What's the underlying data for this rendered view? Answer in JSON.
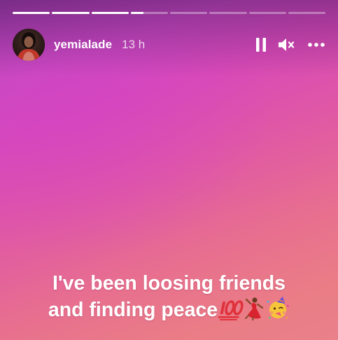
{
  "story": {
    "progress": {
      "segments": [
        1,
        1,
        1,
        0.35,
        0,
        0,
        0,
        0
      ]
    },
    "author": {
      "username": "yemialade",
      "avatar_icon": "profile-photo",
      "timestamp": "13 h"
    },
    "controls": {
      "pause_icon": "pause-icon",
      "mute_icon": "speaker-muted-icon",
      "more_icon": "more-options-icon"
    },
    "caption": {
      "line1": "I've been loosing friends",
      "line2": "and finding peace",
      "emojis": [
        "hundred-points-icon",
        "dancing-woman-icon",
        "party-face-icon"
      ]
    },
    "colors": {
      "gradient_top": "#c94bc0",
      "gradient_bottom": "#e9808a",
      "text": "#ffffff"
    }
  }
}
